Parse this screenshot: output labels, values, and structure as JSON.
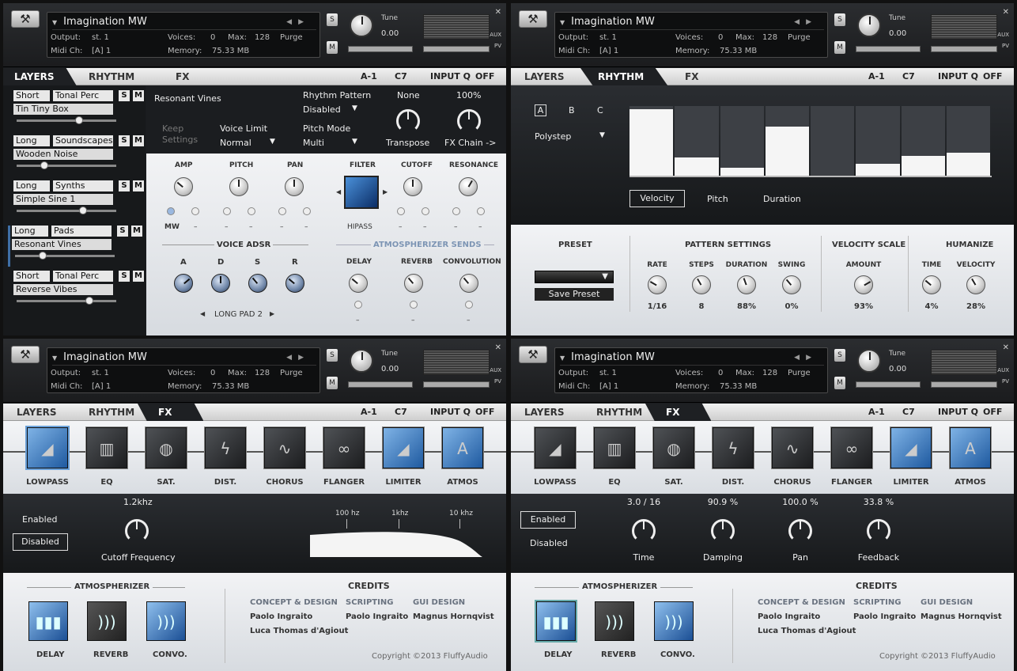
{
  "header": {
    "title": "Imagination MW",
    "output_label": "Output:",
    "output_value": "st. 1",
    "voices_label": "Voices:",
    "voices_value": "0",
    "max_label": "Max:",
    "max_value": "128",
    "purge": "Purge",
    "midi_label": "Midi Ch:",
    "midi_value": "[A] 1",
    "memory_label": "Memory:",
    "memory_value": "75.33 MB",
    "s_btn": "S",
    "m_btn": "M",
    "tune_label": "Tune",
    "tune_value": "0.00",
    "close": "✕",
    "aux": "AUX",
    "pv": "PV"
  },
  "tabs": {
    "layers": "LAYERS",
    "rhythm": "RHYTHM",
    "fx": "FX",
    "key": "A-1",
    "key_high": "C7",
    "inputq": "INPUT Q",
    "inputq_val": "OFF"
  },
  "layers_panel": {
    "layers": [
      {
        "a": "Short",
        "b": "Tonal Perc",
        "name": "Tin Tiny Box",
        "level": 0.64
      },
      {
        "a": "Long",
        "b": "Soundscapes",
        "name": "Wooden Noise",
        "level": 0.26
      },
      {
        "a": "Long",
        "b": "Synths",
        "name": "Simple Sine 1",
        "level": 0.68
      },
      {
        "a": "Long",
        "b": "Pads",
        "name": "Resonant Vines",
        "level": 0.26
      },
      {
        "a": "Short",
        "b": "Tonal Perc",
        "name": "Reverse Vibes",
        "level": 0.75
      }
    ],
    "s": "S",
    "m": "M",
    "selected_name": "Resonant Vines",
    "keep_settings": "Keep Settings",
    "voice_limit_label": "Voice Limit",
    "voice_limit_value": "Normal",
    "rhythm_pattern_label": "Rhythm Pattern",
    "rhythm_pattern_value": "Disabled",
    "pitch_mode_label": "Pitch Mode",
    "pitch_mode_value": "Multi",
    "transpose_value": "None",
    "transpose_label": "Transpose",
    "fxchain_value": "100%",
    "fxchain_label": "FX Chain ->",
    "amp": "AMP",
    "pitch": "PITCH",
    "pan": "PAN",
    "filter": "FILTER",
    "cutoff": "CUTOFF",
    "resonance": "RESONANCE",
    "mw": "MW",
    "dash": "–",
    "hipass": "HIPASS",
    "voice_adsr": "VOICE ADSR",
    "atmos_sends": "ATMOSPHERIZER SENDS",
    "adsr": [
      "A",
      "D",
      "S",
      "R"
    ],
    "delay": "DELAY",
    "reverb": "REVERB",
    "convolution": "CONVOLUTION",
    "long_pad": "LONG PAD 2"
  },
  "rhythm_panel": {
    "abc": [
      "A",
      "B",
      "C"
    ],
    "mode": "Polystep",
    "steps": [
      1.0,
      0.27,
      0.12,
      0.74,
      0.0,
      0.18,
      0.3,
      0.35
    ],
    "tabs": [
      "Velocity",
      "Pitch",
      "Duration"
    ],
    "preset": "PRESET",
    "save_preset": "Save Preset",
    "pattern_settings": "PATTERN SETTINGS",
    "velocity_scale": "VELOCITY SCALE",
    "humanize": "HUMANIZE",
    "knobs": [
      {
        "label": "RATE",
        "value": "1/16"
      },
      {
        "label": "STEPS",
        "value": "8"
      },
      {
        "label": "DURATION",
        "value": "88%"
      },
      {
        "label": "SWING",
        "value": "0%"
      },
      {
        "label": "AMOUNT",
        "value": "93%"
      },
      {
        "label": "TIME",
        "value": "4%"
      },
      {
        "label": "VELOCITY",
        "value": "28%"
      }
    ]
  },
  "fx_panel": {
    "effects": [
      "LOWPASS",
      "EQ",
      "SAT.",
      "DIST.",
      "CHORUS",
      "FLANGER",
      "LIMITER",
      "ATMOS"
    ],
    "enabled": "Enabled",
    "disabled": "Disabled",
    "cutoff_value": "1.2khz",
    "cutoff_label": "Cutoff Frequency",
    "freq_marks": [
      "100 hz",
      "1khz",
      "10 khz"
    ],
    "delay_params": [
      {
        "value": "3.0 / 16",
        "label": "Time"
      },
      {
        "value": "90.9 %",
        "label": "Damping"
      },
      {
        "value": "100.0 %",
        "label": "Pan"
      },
      {
        "value": "33.8 %",
        "label": "Feedback"
      }
    ],
    "atmospherizer": "ATMOSPHERIZER",
    "atmos_items": [
      "DELAY",
      "REVERB",
      "CONVO."
    ],
    "credits": "CREDITS",
    "concept": "CONCEPT & DESIGN",
    "concept_names": [
      "Paolo Ingraito",
      "Luca Thomas d'Agiout"
    ],
    "scripting": "SCRIPTING",
    "scripting_name": "Paolo Ingraito",
    "gui": "GUI DESIGN",
    "gui_name": "Magnus Hornqvist",
    "copyright": "Copyright ©2013 FluffyAudio"
  }
}
